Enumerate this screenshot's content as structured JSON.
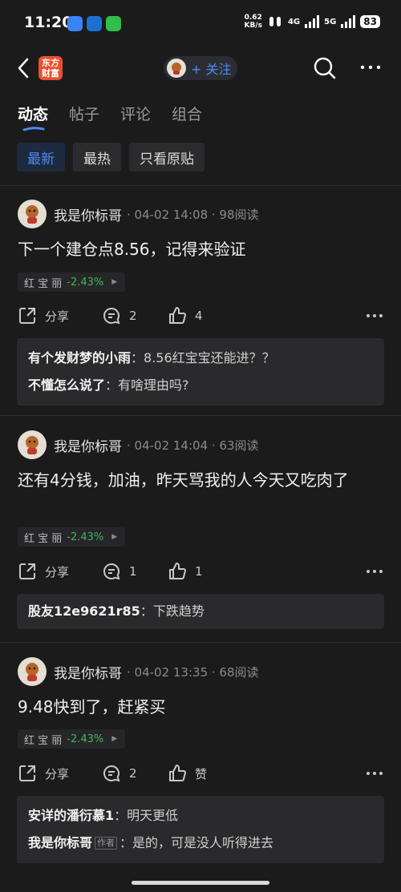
{
  "status_bar": {
    "time": "11:20",
    "net_speed": "0.62",
    "net_unit": "KB/s",
    "network_1": "4G",
    "network_2": "5G",
    "battery": "83"
  },
  "nav": {
    "brand_line1": "东方",
    "brand_line2": "财富",
    "follow_label": "+ 关注"
  },
  "tabs": [
    {
      "label": "动态"
    },
    {
      "label": "帖子"
    },
    {
      "label": "评论"
    },
    {
      "label": "组合"
    }
  ],
  "filters": [
    {
      "label": "最新"
    },
    {
      "label": "最热"
    },
    {
      "label": "只看原贴"
    }
  ],
  "colors": {
    "accent": "#4e8bf0",
    "stock_change": "#3fb55c",
    "background": "#1b1b1c"
  },
  "posts": [
    {
      "author": "我是你标哥",
      "meta": "· 04-02 14:08 · 98阅读",
      "content": "下一个建仓点8.56，记得来验证",
      "stock_name": "红 宝 丽",
      "stock_change": "-2.43%",
      "share_label": "分享",
      "comment_count": "2",
      "like_count": "4",
      "comments": [
        {
          "user": "有个发财梦的小雨",
          "sep": "：",
          "text": "8.56红宝宝还能进？？"
        },
        {
          "user": "不懂怎么说了",
          "sep": "：",
          "text": "有啥理由吗?"
        }
      ]
    },
    {
      "author": "我是你标哥",
      "meta": "· 04-02 14:04 · 63阅读",
      "content": "还有4分钱，加油，昨天骂我的人今天又吃肉了",
      "stock_name": "红 宝 丽",
      "stock_change": "-2.43%",
      "share_label": "分享",
      "comment_count": "1",
      "like_count": "1",
      "comments": [
        {
          "user": "股友12e9621r85",
          "sep": "：",
          "text": "下跌趋势"
        }
      ]
    },
    {
      "author": "我是你标哥",
      "meta": "· 04-02 13:35 · 68阅读",
      "content": "9.48快到了，赶紧买",
      "stock_name": "红 宝 丽",
      "stock_change": "-2.43%",
      "share_label": "分享",
      "comment_count": "2",
      "like_count": "赞",
      "comments": [
        {
          "user": "安详的潘衍慕1",
          "sep": "：",
          "text": "明天更低"
        },
        {
          "user": "我是你标哥",
          "tag": "作者",
          "sep": "：",
          "text": "是的，可是没人听得进去"
        }
      ]
    }
  ]
}
